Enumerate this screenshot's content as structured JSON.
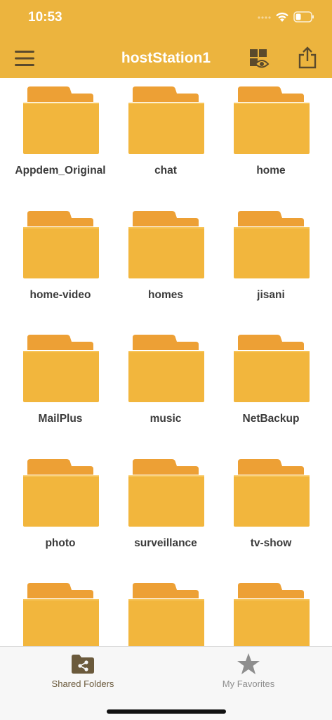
{
  "status_bar": {
    "time": "10:53",
    "icons": [
      "signal-dots-icon",
      "wifi-icon",
      "battery-icon"
    ]
  },
  "nav_bar": {
    "title": "hostStation1",
    "left_icon": "hamburger-menu-icon",
    "right_icons": [
      "view-mode-icon",
      "share-icon"
    ]
  },
  "folders": [
    {
      "name": "Appdem_Original"
    },
    {
      "name": "chat"
    },
    {
      "name": "home"
    },
    {
      "name": "home-video"
    },
    {
      "name": "homes"
    },
    {
      "name": "jisani"
    },
    {
      "name": "MailPlus"
    },
    {
      "name": "music"
    },
    {
      "name": "NetBackup"
    },
    {
      "name": "photo"
    },
    {
      "name": "surveillance"
    },
    {
      "name": "tv-show"
    },
    {
      "name": ""
    },
    {
      "name": ""
    },
    {
      "name": ""
    }
  ],
  "tab_bar": {
    "tabs": [
      {
        "label": "Shared Folders",
        "icon": "shared-folder-icon",
        "active": true
      },
      {
        "label": "My Favorites",
        "icon": "star-icon",
        "active": false
      }
    ]
  },
  "colors": {
    "accent": "#ecb43e",
    "folder_front": "#f2b63d",
    "folder_tab": "#eda035",
    "active_tab": "#6b5a3c",
    "inactive_tab": "#8e8e8e"
  }
}
